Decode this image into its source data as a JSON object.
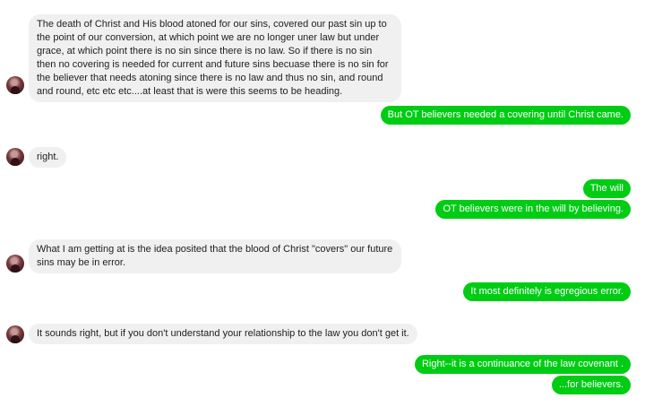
{
  "conversation": {
    "messages": [
      {
        "direction": "incoming",
        "text": "The death of Christ and His blood atoned for our sins, covered our past sin up to the point of our conversion, at which point we are no longer uner law but under grace, at which point there is no sin since there is no law.  So if there is no sin then no covering is needed for current and future sins becuase there is no sin for the believer that needs atoning since there is no law and thus no sin, and round and round, etc etc etc....at least that is were this seems to be heading."
      },
      {
        "direction": "outgoing",
        "text": "But OT believers needed a covering until Christ came."
      },
      {
        "direction": "incoming",
        "text": "right."
      },
      {
        "direction": "outgoing",
        "text": "The will"
      },
      {
        "direction": "outgoing",
        "text": "OT believers were in the will by believing."
      },
      {
        "direction": "incoming",
        "text": "What I am getting at is the idea posited that the blood of Christ \"covers\" our future sins may be in error."
      },
      {
        "direction": "outgoing",
        "text": "It most definitely is egregious error."
      },
      {
        "direction": "incoming",
        "text": "It sounds right, but if you don't understand your relationship to the law you don't get it."
      },
      {
        "direction": "outgoing",
        "text": "Right--it is a continuance of the law covenant ."
      },
      {
        "direction": "outgoing",
        "text": "...for believers."
      }
    ]
  },
  "colors": {
    "incoming_bubble": "#f1f0f0",
    "outgoing_bubble": "#00cc14"
  },
  "icons": {
    "avatar": "avatar-icon"
  }
}
